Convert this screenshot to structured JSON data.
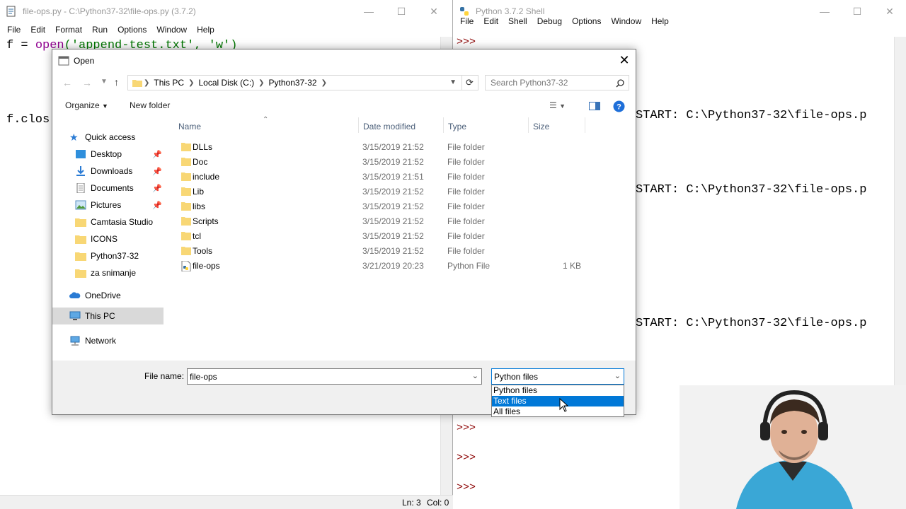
{
  "editor": {
    "title": "file-ops.py - C:\\Python37-32\\file-ops.py (3.7.2)",
    "menu": [
      "File",
      "Edit",
      "Format",
      "Run",
      "Options",
      "Window",
      "Help"
    ],
    "code_line1_prefix": "f = ",
    "code_line1_func": "open",
    "code_line1_args": "('append-test.txt', 'w')",
    "code_line3": "f.clos",
    "status": {
      "line": "Ln: 3",
      "col": "Col: 0"
    }
  },
  "shell": {
    "title": "Python 3.7.2 Shell",
    "menu": [
      "File",
      "Edit",
      "Shell",
      "Debug",
      "Options",
      "Window",
      "Help"
    ],
    "prompt": ">>>",
    "restart_line": "START: C:\\Python37-32\\file-ops.p"
  },
  "dialog": {
    "title": "Open",
    "breadcrumbs": [
      "This PC",
      "Local Disk (C:)",
      "Python37-32"
    ],
    "search_placeholder": "Search Python37-32",
    "organize_label": "Organize",
    "new_folder_label": "New folder",
    "nav": {
      "quick_access": "Quick access",
      "items": [
        "Desktop",
        "Downloads",
        "Documents",
        "Pictures",
        "Camtasia Studio",
        "ICONS",
        "Python37-32",
        "za snimanje"
      ],
      "onedrive": "OneDrive",
      "this_pc": "This PC",
      "network": "Network"
    },
    "columns": {
      "name": "Name",
      "date": "Date modified",
      "type": "Type",
      "size": "Size"
    },
    "files": [
      {
        "name": "DLLs",
        "date": "3/15/2019 21:52",
        "type": "File folder",
        "size": ""
      },
      {
        "name": "Doc",
        "date": "3/15/2019 21:52",
        "type": "File folder",
        "size": ""
      },
      {
        "name": "include",
        "date": "3/15/2019 21:51",
        "type": "File folder",
        "size": ""
      },
      {
        "name": "Lib",
        "date": "3/15/2019 21:52",
        "type": "File folder",
        "size": ""
      },
      {
        "name": "libs",
        "date": "3/15/2019 21:52",
        "type": "File folder",
        "size": ""
      },
      {
        "name": "Scripts",
        "date": "3/15/2019 21:52",
        "type": "File folder",
        "size": ""
      },
      {
        "name": "tcl",
        "date": "3/15/2019 21:52",
        "type": "File folder",
        "size": ""
      },
      {
        "name": "Tools",
        "date": "3/15/2019 21:52",
        "type": "File folder",
        "size": ""
      },
      {
        "name": "file-ops",
        "date": "3/21/2019 20:23",
        "type": "Python File",
        "size": "1 KB"
      }
    ],
    "file_name_label": "File name:",
    "file_name_value": "file-ops",
    "file_type_selected": "Python files",
    "file_type_options": [
      "Python files",
      "Text files",
      "All files"
    ]
  },
  "colors": {
    "accent": "#0078d7",
    "folder": "#f8d775",
    "prompt": "#8b0000",
    "string": "#007700",
    "builtin": "#900090"
  }
}
